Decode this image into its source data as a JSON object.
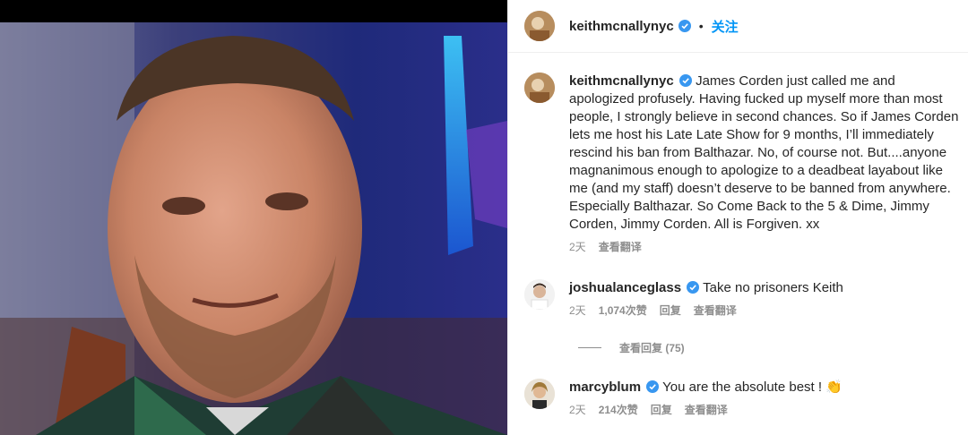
{
  "post": {
    "username": "keithmcnallynyc",
    "separator": "•",
    "follow_label": "关注"
  },
  "caption": {
    "username": "keithmcnallynyc",
    "text": "James Corden just called me and apologized profusely. Having fucked up myself more than most people, I strongly believe in second chances. So if James Corden lets me host his Late Late Show for 9 months, I’ll immediately rescind his ban from Balthazar. No, of course not. But....anyone magnanimous enough to apologize to a deadbeat layabout like me (and my staff) doesn’t deserve to be banned from anywhere. Especially Balthazar. So Come Back to the 5 & Dime, Jimmy Corden, Jimmy Corden. All is Forgiven. xx",
    "time": "2天",
    "translate_label": "查看翻译"
  },
  "comments": [
    {
      "username": "joshualanceglass",
      "text": "Take no prisoners Keith",
      "time": "2天",
      "likes": "1,074次赞",
      "reply_label": "回复",
      "translate_label": "查看翻译"
    },
    {
      "username": "marcyblum",
      "text": "You are the absolute best ! ",
      "emoji": "👏",
      "time": "2天",
      "likes": "214次赞",
      "reply_label": "回复",
      "translate_label": "查看翻译"
    }
  ],
  "view_replies_label": "查看回复 (75)",
  "colors": {
    "accent": "#0095f6",
    "verified": "#3897f0",
    "muted": "#8e8e8e",
    "text": "#262626"
  },
  "icons": [
    "verified-badge-icon",
    "clap-emoji-icon"
  ]
}
